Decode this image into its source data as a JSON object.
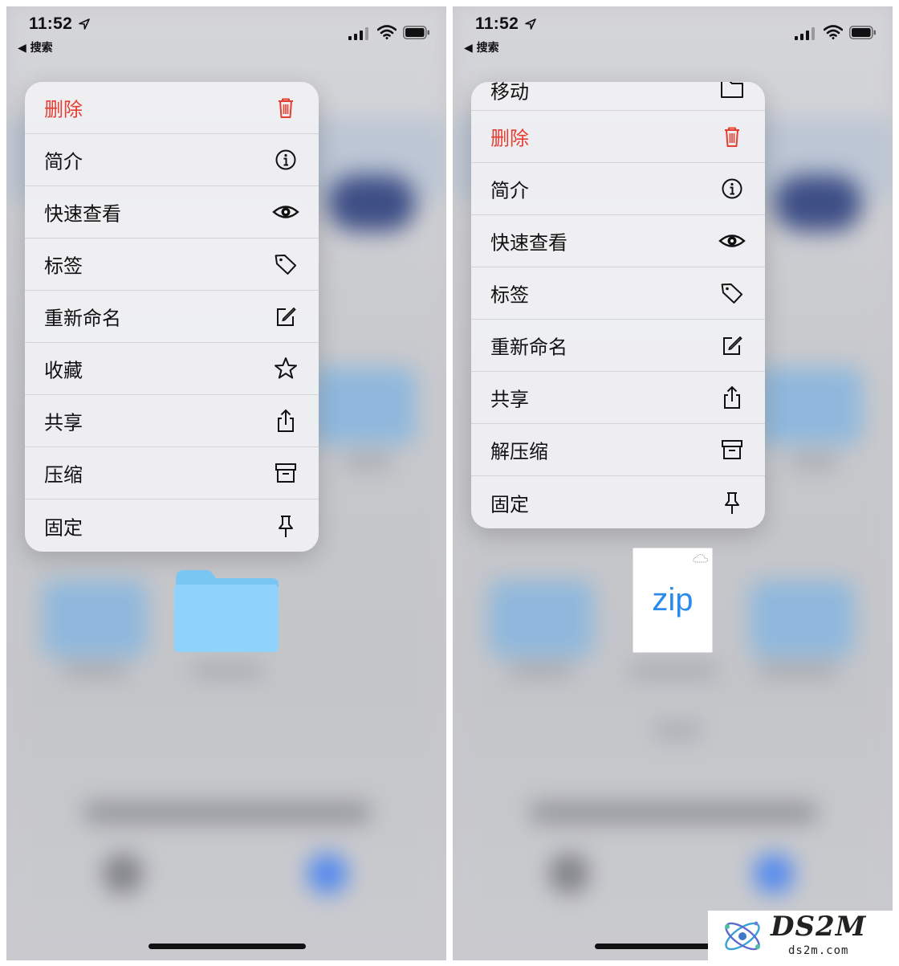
{
  "status": {
    "time": "11:52",
    "back_label": "◀ 搜索"
  },
  "left_menu": {
    "items": [
      {
        "label": "删除",
        "icon": "trash-icon",
        "danger": true
      },
      {
        "label": "简介",
        "icon": "info-icon"
      },
      {
        "label": "快速查看",
        "icon": "eye-icon"
      },
      {
        "label": "标签",
        "icon": "tag-icon"
      },
      {
        "label": "重新命名",
        "icon": "rename-icon"
      },
      {
        "label": "收藏",
        "icon": "star-icon"
      },
      {
        "label": "共享",
        "icon": "share-icon"
      },
      {
        "label": "压缩",
        "icon": "archive-icon"
      },
      {
        "label": "固定",
        "icon": "pin-icon"
      }
    ]
  },
  "right_menu": {
    "items": [
      {
        "label": "移动",
        "icon": "folder-icon"
      },
      {
        "label": "删除",
        "icon": "trash-icon",
        "danger": true
      },
      {
        "label": "简介",
        "icon": "info-icon"
      },
      {
        "label": "快速查看",
        "icon": "eye-icon"
      },
      {
        "label": "标签",
        "icon": "tag-icon"
      },
      {
        "label": "重新命名",
        "icon": "rename-icon"
      },
      {
        "label": "共享",
        "icon": "share-icon"
      },
      {
        "label": "解压缩",
        "icon": "archive-icon"
      },
      {
        "label": "固定",
        "icon": "pin-icon"
      }
    ]
  },
  "zip_file": {
    "text": "zip"
  },
  "watermark": {
    "brand": "DS2M",
    "domain": "ds2m.com"
  },
  "colors": {
    "danger": "#e63d31",
    "folder": "#8fd2fb",
    "zip_text": "#2b8bea"
  }
}
